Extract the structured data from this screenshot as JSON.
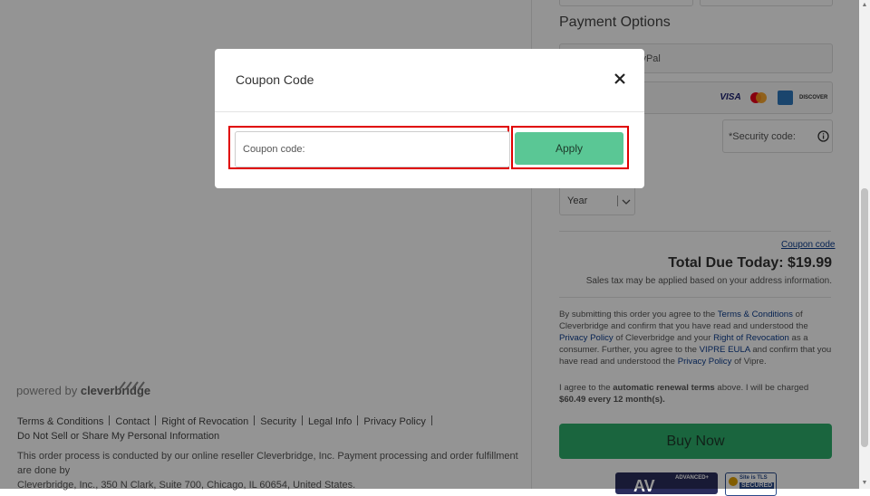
{
  "left_footer": {
    "powered_by": "powered by",
    "brand": "cleverbridge",
    "links": [
      "Terms & Conditions",
      "Contact",
      "Right of Revocation",
      "Security",
      "Legal Info",
      "Privacy Policy"
    ],
    "do_not_sell": "Do Not Sell or Share My Personal Information",
    "disclaimer_line1": "This order process is conducted by our online reseller Cleverbridge, Inc. Payment processing and order fulfillment are done by",
    "disclaimer_line2": "Cleverbridge, Inc., 350 N Clark, Suite 700, Chicago, IL 60654, United States."
  },
  "payment": {
    "title": "Payment Options",
    "paypal_label": "PayPal",
    "cards": [
      "VISA",
      "MC",
      "AMEX",
      "DISCOVER"
    ],
    "security_code_placeholder": "*Security code:",
    "info_icon": "info-icon",
    "year_label": "Year"
  },
  "summary": {
    "coupon_link": "Coupon code",
    "total_label": "Total Due Today: $19.99",
    "tax_note": "Sales tax may be applied based on your address information."
  },
  "legal": {
    "p1_a": "By submitting this order you agree to the ",
    "p1_link1": "Terms & Conditions",
    "p1_b": " of Cleverbridge and confirm that you have read and understood the ",
    "p1_link2": "Privacy Policy",
    "p1_c": " of Cleverbridge and your ",
    "p1_link3": "Right of Revocation",
    "p1_d": " as a consumer. Further, you agree to the ",
    "p1_link4": "VIPRE EULA",
    "p1_e": " and confirm that you have read and understood the ",
    "p1_link5": "Privacy Policy",
    "p1_f": " of Vipre.",
    "p2_a": "I agree to the ",
    "p2_bold": "automatic renewal terms",
    "p2_b": " above. I will be charged ",
    "p2_bold2": "$60.49 every 12 month(s)."
  },
  "buy_button": "Buy Now",
  "badges": {
    "av_label": "ADVANCED+",
    "av_short": "AV",
    "tls_line1": "Site is TLS",
    "tls_line2": "SECURED"
  },
  "modal": {
    "title": "Coupon Code",
    "close_icon": "close-icon",
    "input_placeholder": "Coupon code:",
    "apply_label": "Apply"
  },
  "colors": {
    "apply_green": "#5ac795",
    "buy_green": "#2eae6c",
    "link_blue": "#0b3b8c",
    "highlight_red": "#e00000"
  }
}
